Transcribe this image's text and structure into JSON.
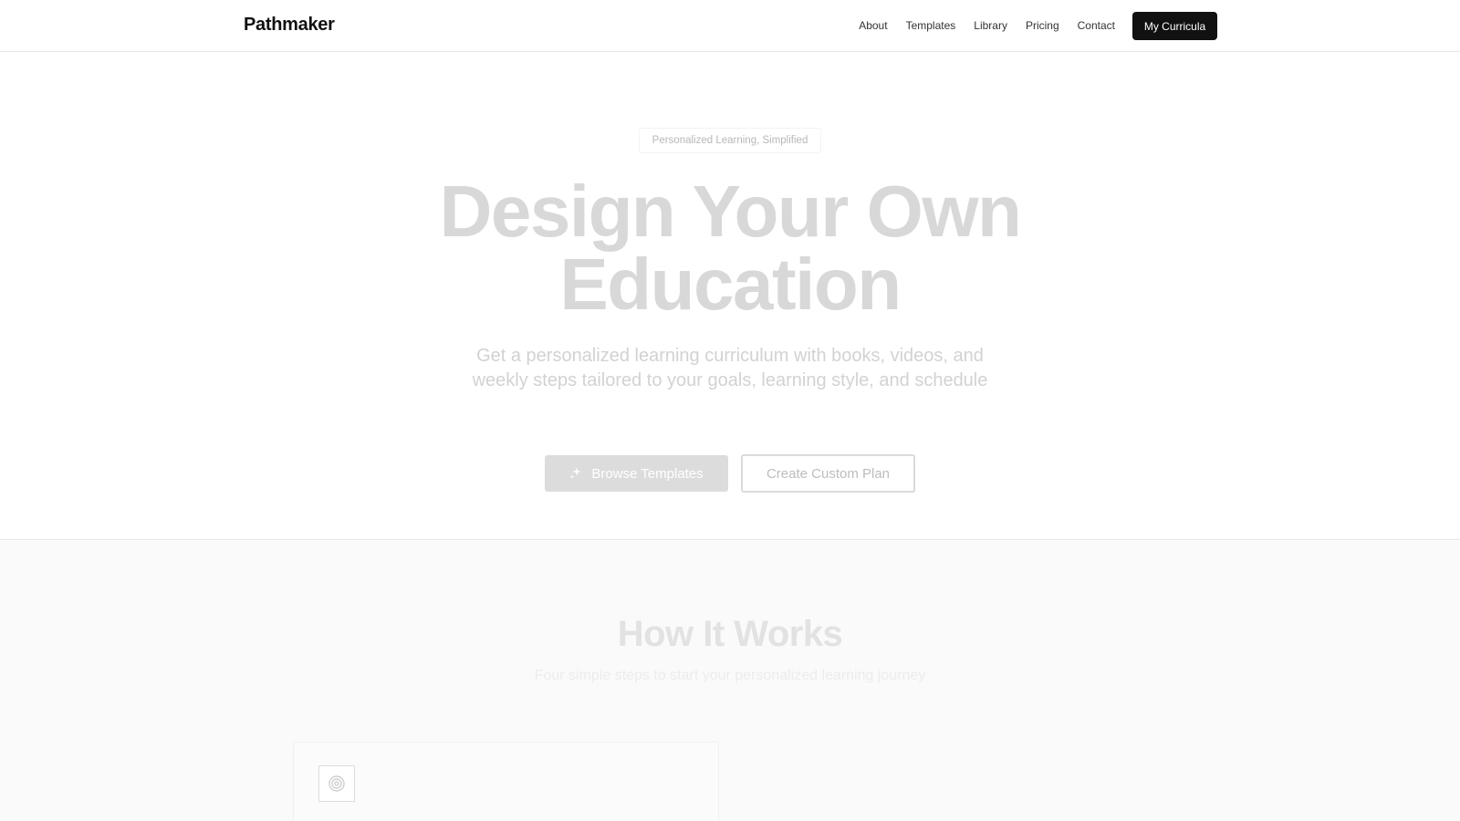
{
  "nav": {
    "brand": "Pathmaker",
    "links": [
      "About",
      "Templates",
      "Library",
      "Pricing",
      "Contact"
    ],
    "cta": "My Curricula"
  },
  "hero": {
    "eyebrow": "Personalized Learning, Simplified",
    "title_line1": "Design Your Own",
    "title_line2": "Education",
    "subtitle": "Get a personalized learning curriculum with books, videos, and weekly steps tailored to your goals, learning style, and schedule",
    "primary_button": "Browse Templates",
    "primary_button_icon": "sparkle-icon",
    "secondary_button": "Create Custom Plan"
  },
  "how_it_works": {
    "title": "How It Works",
    "subtitle": "Four simple steps to start your personalized learning journey",
    "first_step_icon": "target-icon"
  },
  "colors": {
    "nav_cta_bg": "#111111",
    "hero_title": "#d8d8d8",
    "section_bg": "#fafafa"
  }
}
